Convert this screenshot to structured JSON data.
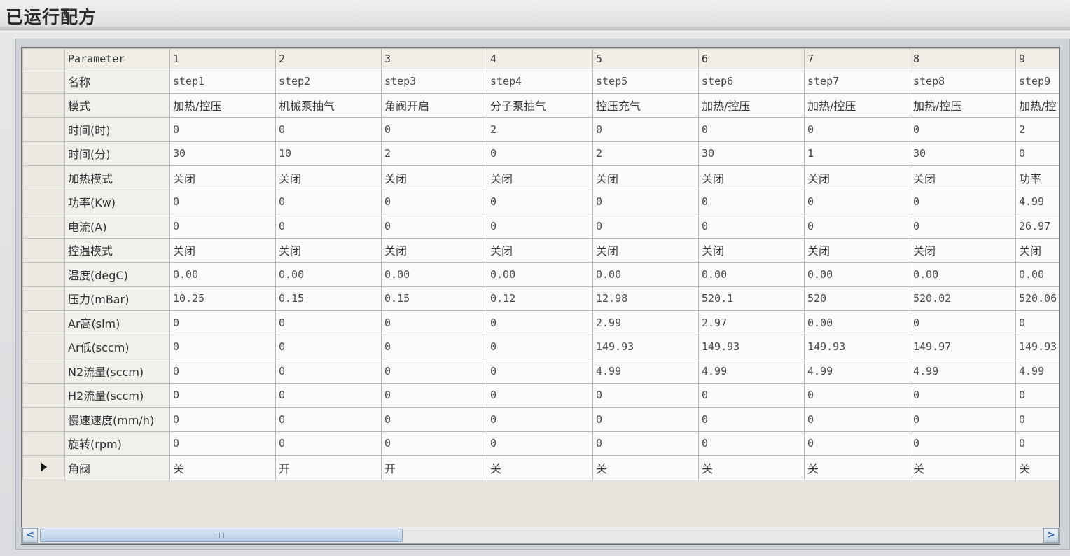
{
  "window": {
    "title": "已运行配方"
  },
  "grid": {
    "corner": "",
    "header": {
      "parameter": "Parameter",
      "columns": [
        "1",
        "2",
        "3",
        "4",
        "5",
        "6",
        "7",
        "8",
        "9"
      ]
    },
    "rows": [
      {
        "label": "名称",
        "cn": false,
        "values": [
          "step1",
          "step2",
          "step3",
          "step4",
          "step5",
          "step6",
          "step7",
          "step8",
          "step9"
        ]
      },
      {
        "label": "模式",
        "cn": true,
        "values": [
          "加热/控压",
          "机械泵抽气",
          "角阀开启",
          "分子泵抽气",
          "控压充气",
          "加热/控压",
          "加热/控压",
          "加热/控压",
          "加热/控"
        ]
      },
      {
        "label": "时间(时)",
        "cn": false,
        "values": [
          "0",
          "0",
          "0",
          "2",
          "0",
          "0",
          "0",
          "0",
          "2"
        ]
      },
      {
        "label": "时间(分)",
        "cn": false,
        "values": [
          "30",
          "10",
          "2",
          "0",
          "2",
          "30",
          "1",
          "30",
          "0"
        ]
      },
      {
        "label": "加热模式",
        "cn": true,
        "values": [
          "关闭",
          "关闭",
          "关闭",
          "关闭",
          "关闭",
          "关闭",
          "关闭",
          "关闭",
          "功率"
        ]
      },
      {
        "label": "功率(Kw)",
        "cn": false,
        "values": [
          "0",
          "0",
          "0",
          "0",
          "0",
          "0",
          "0",
          "0",
          "4.99"
        ]
      },
      {
        "label": "电流(A)",
        "cn": false,
        "values": [
          "0",
          "0",
          "0",
          "0",
          "0",
          "0",
          "0",
          "0",
          "26.97"
        ]
      },
      {
        "label": "控温模式",
        "cn": true,
        "values": [
          "关闭",
          "关闭",
          "关闭",
          "关闭",
          "关闭",
          "关闭",
          "关闭",
          "关闭",
          "关闭"
        ]
      },
      {
        "label": "温度(degC)",
        "cn": false,
        "values": [
          "0.00",
          "0.00",
          "0.00",
          "0.00",
          "0.00",
          "0.00",
          "0.00",
          "0.00",
          "0.00"
        ]
      },
      {
        "label": "压力(mBar)",
        "cn": false,
        "values": [
          "10.25",
          "0.15",
          "0.15",
          "0.12",
          "12.98",
          "520.1",
          "520",
          "520.02",
          "520.06"
        ]
      },
      {
        "label": "Ar高(slm)",
        "cn": false,
        "values": [
          "0",
          "0",
          "0",
          "0",
          "2.99",
          "2.97",
          "0.00",
          "0",
          "0"
        ]
      },
      {
        "label": "Ar低(sccm)",
        "cn": false,
        "values": [
          "0",
          "0",
          "0",
          "0",
          "149.93",
          "149.93",
          "149.93",
          "149.97",
          "149.93"
        ]
      },
      {
        "label": "N2流量(sccm)",
        "cn": false,
        "values": [
          "0",
          "0",
          "0",
          "0",
          "4.99",
          "4.99",
          "4.99",
          "4.99",
          "4.99"
        ]
      },
      {
        "label": "H2流量(sccm)",
        "cn": false,
        "values": [
          "0",
          "0",
          "0",
          "0",
          "0",
          "0",
          "0",
          "0",
          "0"
        ]
      },
      {
        "label": "慢速速度(mm/h)",
        "cn": false,
        "values": [
          "0",
          "0",
          "0",
          "0",
          "0",
          "0",
          "0",
          "0",
          "0"
        ]
      },
      {
        "label": "旋转(rpm)",
        "cn": false,
        "values": [
          "0",
          "0",
          "0",
          "0",
          "0",
          "0",
          "0",
          "0",
          "0"
        ]
      },
      {
        "label": "角阀",
        "cn": true,
        "current": true,
        "values": [
          "关",
          "开",
          "开",
          "关",
          "关",
          "关",
          "关",
          "关",
          "关"
        ]
      }
    ]
  },
  "scrollbar": {
    "left_glyph": "<",
    "right_glyph": ">",
    "position_fraction": 0.0,
    "visible_fraction": 0.35
  },
  "icons": {
    "current_row": "row-pointer-icon",
    "scroll_left": "chevron-left-icon",
    "scroll_right": "chevron-right-icon"
  },
  "colors": {
    "grid_line": "#b6b6b6",
    "cell_bg": "#fbfbfb",
    "header_bg": "#f0ede6",
    "scroll_accent": "#2a5f9e"
  }
}
